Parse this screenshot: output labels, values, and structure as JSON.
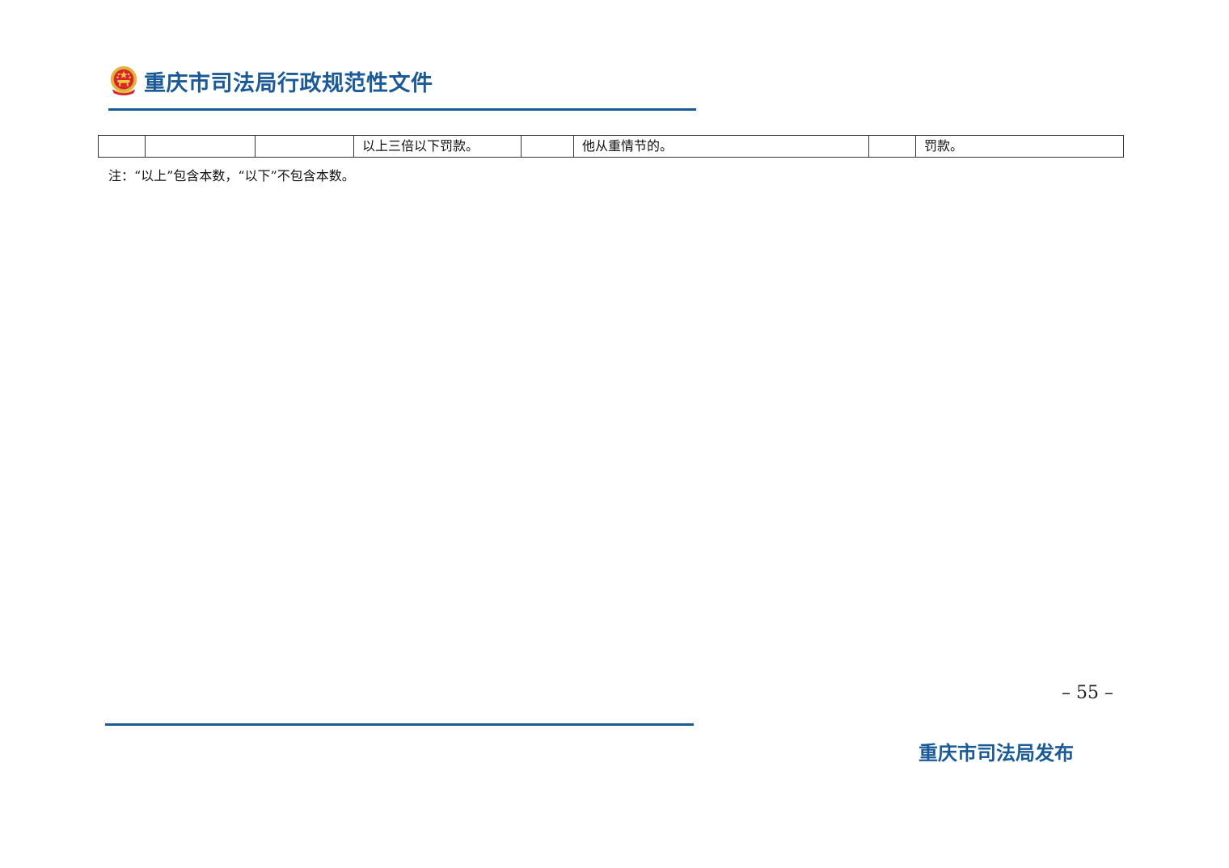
{
  "header": {
    "emblem_icon": "national-emblem-icon",
    "title": "重庆市司法局行政规范性文件",
    "accent_color": "#1a5a96"
  },
  "table": {
    "rows": [
      {
        "cells": [
          "",
          "",
          "",
          "以上三倍以下罚款。",
          "",
          "他从重情节的。",
          "",
          "罚款。"
        ]
      }
    ]
  },
  "note": "注：“以上”包含本数，“以下”不包含本数。",
  "page_number": "– 55 –",
  "footer": {
    "publisher": "重庆市司法局发布"
  }
}
